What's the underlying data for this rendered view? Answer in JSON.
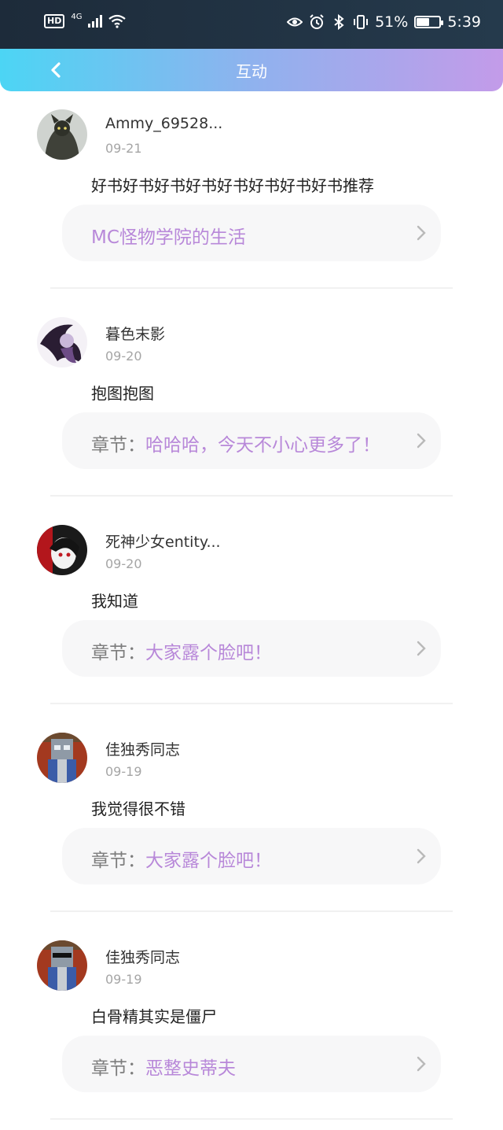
{
  "status_bar": {
    "hd": "HD",
    "network": "4G",
    "battery_percent": "51%",
    "battery_level": 0.51,
    "time": "5:39"
  },
  "header": {
    "title": "互动"
  },
  "colors": {
    "accent": "#b888d9",
    "header_start": "#4cd5f4",
    "header_end": "#c39be9"
  },
  "chapter_prefix": "章节：",
  "items": [
    {
      "username": "Ammy_69528...",
      "date": "09-21",
      "content": "好书好书好书好书好书好书好书好书推荐",
      "card_prefix": "",
      "card_title": "MC怪物学院的生活"
    },
    {
      "username": "暮色末影",
      "date": "09-20",
      "content": "抱图抱图",
      "card_prefix": "章节：",
      "card_title": "哈哈哈，今天不小心更多了！"
    },
    {
      "username": "死神少女entity...",
      "date": "09-20",
      "content": "我知道",
      "card_prefix": "章节：",
      "card_title": "大家露个脸吧！"
    },
    {
      "username": "佳独秀同志",
      "date": "09-19",
      "content": "我觉得很不错",
      "card_prefix": "章节：",
      "card_title": "大家露个脸吧！"
    },
    {
      "username": "佳独秀同志",
      "date": "09-19",
      "content": "白骨精其实是僵尸",
      "card_prefix": "章节：",
      "card_title": "恶整史蒂夫"
    }
  ]
}
